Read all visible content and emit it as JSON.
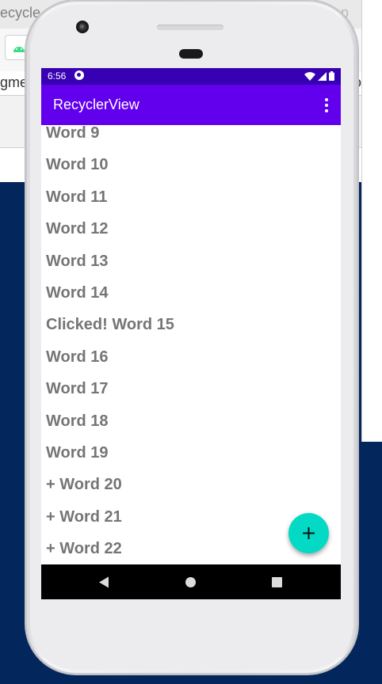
{
  "background": {
    "tab_fragment_left": "ecycle",
    "tab_fragment_right": "ap",
    "bookmark_fragment_left": "gme",
    "bookmark_fragment_right": "o"
  },
  "status_bar": {
    "time": "6:56"
  },
  "app_bar": {
    "title": "RecyclerView",
    "overflow_icon": "more-vert-icon"
  },
  "list": {
    "items": [
      "Word 9",
      "Word 10",
      "Word 11",
      "Word 12",
      "Word 13",
      "Word 14",
      "Clicked! Word 15",
      "Word 16",
      "Word 17",
      "Word 18",
      "Word 19",
      "+ Word 20",
      "+ Word 21",
      "+ Word 22"
    ]
  },
  "fab": {
    "icon": "plus-icon",
    "color": "#03dac5"
  },
  "nav_bar": {
    "back_icon": "back-triangle-icon",
    "home_icon": "home-circle-icon",
    "recents_icon": "recents-square-icon"
  },
  "colors": {
    "status_bar": "#3700b3",
    "app_bar": "#6200ee",
    "item_text": "#757575",
    "desktop_background": "#03265c"
  }
}
